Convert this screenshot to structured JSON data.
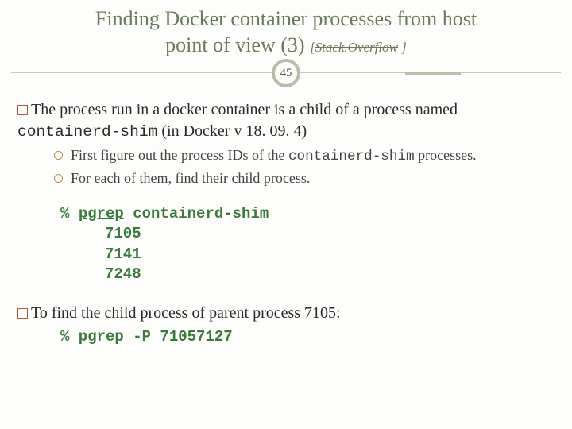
{
  "title": {
    "line1": "Finding Docker container processes from host",
    "line2_prefix": "point of view (3) ",
    "citation_open": "[",
    "citation_link": "Stack.Overflow",
    "citation_close": " ]"
  },
  "page_number": "45",
  "p1": {
    "pre": "The process run in a docker container is a child of a process named ",
    "code": "containerd-shim",
    "post": " (in Docker v 18. 09. 4)"
  },
  "sub": {
    "item1_pre": "First figure out the process IDs of the ",
    "item1_code": "containerd-shim",
    "item1_post": "  processes.",
    "item2": "For each of them, find their child process."
  },
  "code1": {
    "prompt": "%",
    "cmd": "pgrep",
    "arg": "containerd-shim",
    "out1": "7105",
    "out2": "7141",
    "out3": "7248"
  },
  "p2": "To find the child process of parent process 7105:",
  "code2": {
    "prompt": "%",
    "rest": " pgrep -P 71057127"
  }
}
